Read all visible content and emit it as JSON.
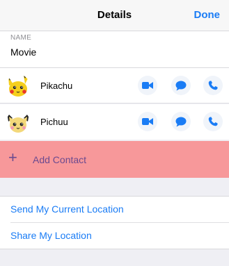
{
  "navbar": {
    "title": "Details",
    "done_label": "Done"
  },
  "name_section": {
    "label": "NAME",
    "value": "Movie"
  },
  "contacts": [
    {
      "name": "Pikachu",
      "avatar": "pikachu-avatar"
    },
    {
      "name": "Pichuu",
      "avatar": "pichu-avatar"
    }
  ],
  "add_contact": {
    "label": "Add Contact",
    "icon": "plus-icon"
  },
  "location": {
    "send_current": "Send My Current Location",
    "share": "Share My Location"
  },
  "colors": {
    "accent": "#1a7cf5",
    "add_row_bg": "#f7989a",
    "add_row_text": "#6b4a8f"
  }
}
